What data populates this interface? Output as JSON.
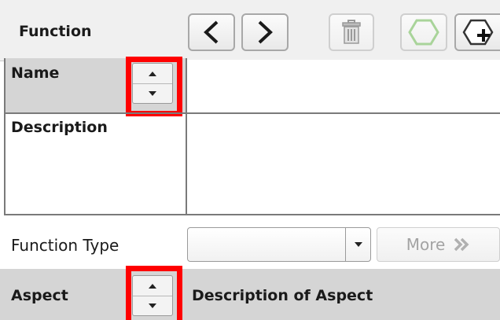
{
  "header": {
    "title": "Function"
  },
  "toolbar": {
    "prev_icon": "chevron-left-icon",
    "next_icon": "chevron-right-icon",
    "delete_icon": "trash-icon",
    "hexagon_icon": "hexagon-icon",
    "add_icon": "add-hexagon-icon"
  },
  "fields": {
    "name_label": "Name",
    "name_value": "",
    "description_label": "Description",
    "description_value": "",
    "function_type_label": "Function Type",
    "function_type_value": "",
    "more_label": "More"
  },
  "aspect": {
    "label": "Aspect",
    "description_header": "Description of Aspect"
  },
  "colors": {
    "highlight": "#ff0000",
    "grid": "#7a7a7a",
    "header_bg": "#f0f0f0",
    "row_bg": "#d5d5d5"
  }
}
